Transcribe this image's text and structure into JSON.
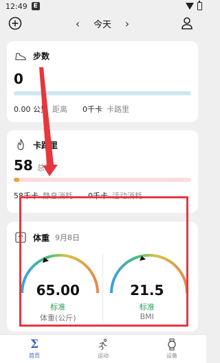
{
  "status_bar": {
    "time": "12:49",
    "badge": "E"
  },
  "top_bar": {
    "prev": "‹",
    "date": "今天",
    "next": "›"
  },
  "steps": {
    "title": "步数",
    "value": "0",
    "progress": 0,
    "distance_value": "0.00 公里",
    "distance_label": "距离",
    "calories_value": "0千卡",
    "calories_label": "卡路里"
  },
  "calories": {
    "title": "卡路里",
    "value": "58",
    "unit": "总计",
    "progress": 0.03,
    "resting_value": "58千卡",
    "resting_label": "静息消耗",
    "active_value": "0千卡",
    "active_label": "活动消耗"
  },
  "weight": {
    "title": "体重",
    "date": "9月8日",
    "gauges": [
      {
        "value": "65.00",
        "status": "标准",
        "label": "体重(公斤)"
      },
      {
        "value": "21.5",
        "status": "标准",
        "label": "BMI"
      }
    ]
  },
  "bottom_nav": [
    {
      "label": "首页",
      "icon": "sigma-icon",
      "active": true
    },
    {
      "label": "运动",
      "icon": "run-icon",
      "active": false
    },
    {
      "label": "设备",
      "icon": "watch-icon",
      "active": false
    }
  ],
  "colors": {
    "accent": "#3a63c6",
    "annotation": "#e8363d",
    "status_good": "#2a9a56"
  }
}
